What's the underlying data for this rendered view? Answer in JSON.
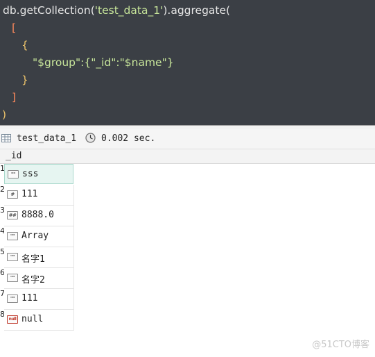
{
  "editor": {
    "line1": {
      "prefix": "db.getCollection(",
      "arg": "'test_data_1'",
      "suffix": ").aggregate("
    },
    "line2": "[",
    "line3": "{",
    "line4": {
      "key": "\"$group\"",
      "colon": ":{",
      "inner_key": "\"_id\"",
      "inner_colon": ":",
      "inner_val": "\"$name\"",
      "close": "}"
    },
    "line5": "}",
    "line6": "]",
    "line7": ")"
  },
  "status": {
    "collection": "test_data_1",
    "time": "0.002 sec."
  },
  "grid": {
    "column": "_id",
    "rows": [
      {
        "num": "1",
        "icon": "\"\"",
        "type": "string",
        "value": "sss"
      },
      {
        "num": "2",
        "icon": "#",
        "type": "int",
        "value": "111"
      },
      {
        "num": "3",
        "icon": "##",
        "type": "double",
        "value": "8888.0"
      },
      {
        "num": "4",
        "icon": "\"\"",
        "type": "string",
        "value": "Array"
      },
      {
        "num": "5",
        "icon": "\"\"",
        "type": "string",
        "value": "名字1"
      },
      {
        "num": "6",
        "icon": "\"\"",
        "type": "string",
        "value": "名字2"
      },
      {
        "num": "7",
        "icon": "\"\"",
        "type": "string",
        "value": "111"
      },
      {
        "num": "8",
        "icon": "null",
        "type": "null",
        "value": "null"
      }
    ]
  },
  "watermark": "@51CTO博客",
  "colors": {
    "editor_bg": "#3b3f45",
    "string": "#c7e59a",
    "bracket": "#ff8a5c",
    "paren": "#e8c06a",
    "selected_row": "#e6f5f1"
  }
}
